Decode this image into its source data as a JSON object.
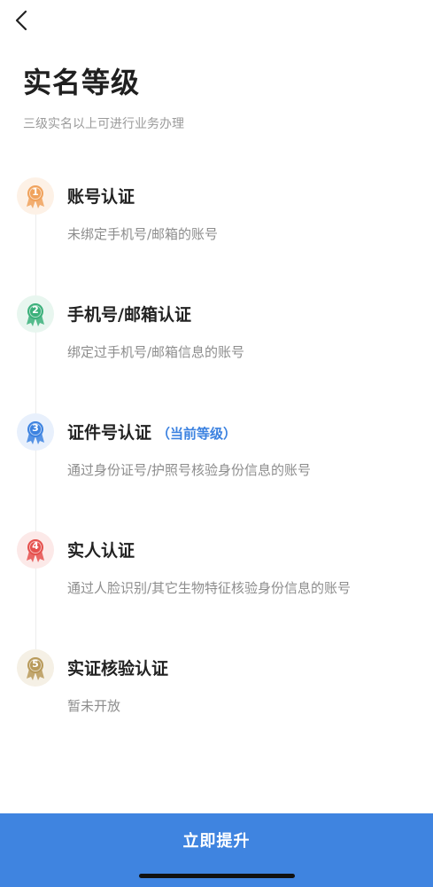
{
  "header": {
    "title": "实名等级",
    "subtitle": "三级实名以上可进行业务办理"
  },
  "levels": [
    {
      "num": "1",
      "title": "账号认证",
      "tag": "",
      "desc": "未绑定手机号/邮箱的账号",
      "color": "#f0a25c",
      "bg": "#fdf1e6"
    },
    {
      "num": "2",
      "title": "手机号/邮箱认证",
      "tag": "",
      "desc": "绑定过手机号/邮箱信息的账号",
      "color": "#3bb07a",
      "bg": "#e8f6ef"
    },
    {
      "num": "3",
      "title": "证件号认证",
      "tag": "（当前等级）",
      "desc": "通过身份证号/护照号核验身份信息的账号",
      "color": "#3c82e0",
      "bg": "#e8f0fc"
    },
    {
      "num": "4",
      "title": "实人认证",
      "tag": "",
      "desc": "通过人脸识别/其它生物特征核验身份信息的账号",
      "color": "#e5504d",
      "bg": "#fce9e8"
    },
    {
      "num": "5",
      "title": "实证核验认证",
      "tag": "",
      "desc": "暂未开放",
      "color": "#b89a5a",
      "bg": "#f5f0e5"
    }
  ],
  "action": {
    "upgrade_label": "立即提升"
  }
}
